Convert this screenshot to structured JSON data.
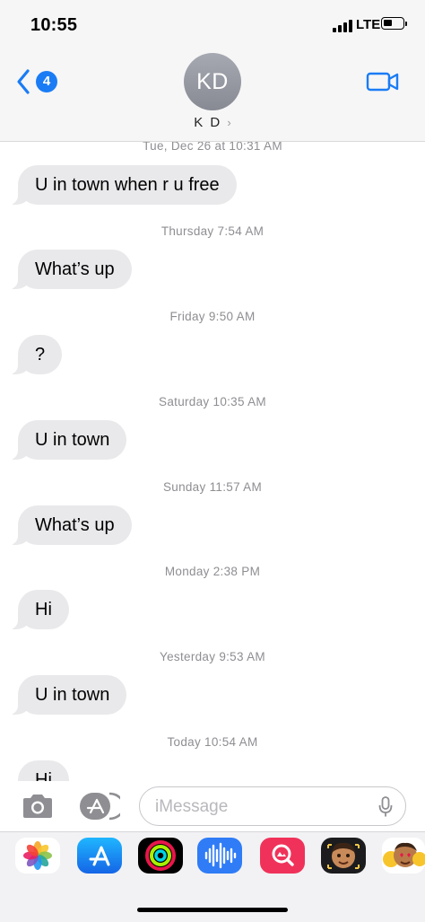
{
  "status_bar": {
    "time": "10:55",
    "network": "LTE",
    "battery_level_percent": 45
  },
  "header": {
    "back_badge_count": "4",
    "avatar_initials": "KD",
    "contact_name": "K D",
    "contact_chevron": "›",
    "icons": [
      "chevron-left-icon",
      "video-camera-icon"
    ]
  },
  "conversation": [
    {
      "timestamp": "Tue, Dec 26 at 10:31 AM",
      "message": "U in town when r u free"
    },
    {
      "timestamp": "Thursday 7:54 AM",
      "message": "What’s up"
    },
    {
      "timestamp": "Friday 9:50 AM",
      "message": "?"
    },
    {
      "timestamp": "Saturday 10:35 AM",
      "message": "U in town"
    },
    {
      "timestamp": "Sunday 11:57 AM",
      "message": "What’s up"
    },
    {
      "timestamp": "Monday 2:38 PM",
      "message": "Hi"
    },
    {
      "timestamp": "Yesterday 9:53 AM",
      "message": "U in town"
    },
    {
      "timestamp": "Today 10:54 AM",
      "message": "Hi"
    }
  ],
  "input_bar": {
    "placeholder": "iMessage",
    "icons": [
      "camera-icon",
      "app-store-icon",
      "microphone-icon"
    ]
  },
  "app_drawer": {
    "apps": [
      "photos-icon",
      "app-store-icon",
      "activity-icon",
      "audio-message-icon",
      "search-images-icon",
      "memoji-icon",
      "emoji-stickers-icon"
    ],
    "colors": {
      "accent_blue": "#1a7cf5",
      "bubble_gray": "#e9e9eb"
    }
  }
}
